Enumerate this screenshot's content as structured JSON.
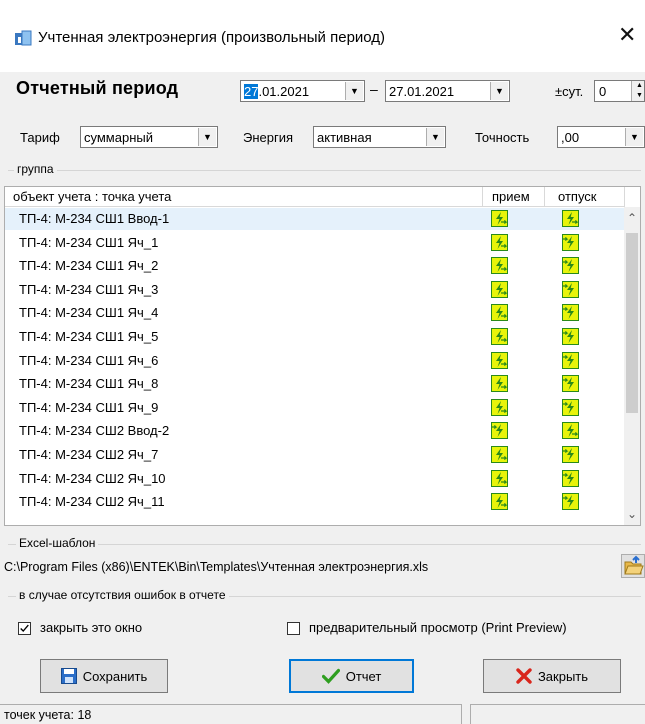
{
  "window": {
    "title": "Учтенная электроэнергия (произвольный период)",
    "close_glyph": "✕"
  },
  "period": {
    "label": "Отчетный период",
    "date_from": {
      "selected_part": "27",
      "rest": ".01.2021"
    },
    "dash": "–",
    "date_to": "27.01.2021",
    "days_label": "±сут.",
    "days_value": "0"
  },
  "filters": {
    "tariff_label": "Тариф",
    "tariff_value": "суммарный",
    "energy_label": "Энергия",
    "energy_value": "активная",
    "precision_label": "Точность",
    "precision_value": ",00"
  },
  "group": {
    "title": "группа",
    "columns": [
      "объект учета : точка учета",
      "прием",
      "отпуск"
    ],
    "rows": [
      {
        "name": "ТП-4: М-234 СШ1 Ввод-1",
        "recv": "b",
        "send": "b"
      },
      {
        "name": "ТП-4: М-234 СШ1 Яч_1",
        "recv": "b",
        "send": "a"
      },
      {
        "name": "ТП-4: М-234 СШ1 Яч_2",
        "recv": "b",
        "send": "a"
      },
      {
        "name": "ТП-4: М-234 СШ1 Яч_3",
        "recv": "b",
        "send": "a"
      },
      {
        "name": "ТП-4: М-234 СШ1 Яч_4",
        "recv": "b",
        "send": "a"
      },
      {
        "name": "ТП-4: М-234 СШ1 Яч_5",
        "recv": "b",
        "send": "a"
      },
      {
        "name": "ТП-4: М-234 СШ1 Яч_6",
        "recv": "b",
        "send": "a"
      },
      {
        "name": "ТП-4: М-234 СШ1 Яч_8",
        "recv": "b",
        "send": "a"
      },
      {
        "name": "ТП-4: М-234 СШ1 Яч_9",
        "recv": "b",
        "send": "a"
      },
      {
        "name": "ТП-4: М-234 СШ2 Ввод-2",
        "recv": "a",
        "send": "b"
      },
      {
        "name": "ТП-4: М-234 СШ2 Яч_7",
        "recv": "b",
        "send": "a"
      },
      {
        "name": "ТП-4: М-234 СШ2 Яч_10",
        "recv": "b",
        "send": "a"
      },
      {
        "name": "ТП-4: М-234 СШ2 Яч_11",
        "recv": "b",
        "send": "a"
      }
    ]
  },
  "excel": {
    "title": "Excel-шаблон",
    "path": "C:\\Program Files (x86)\\ENTEK\\Bin\\Templates\\Учтенная электроэнергия.xls"
  },
  "errors_group": {
    "title": "в случае отсутствия ошибок в отчете",
    "close_window_label": "закрыть это окно",
    "close_window_checked": true,
    "preview_label": "предварительный просмотр (Print Preview)",
    "preview_checked": false
  },
  "buttons": {
    "save": "Сохранить",
    "report": "Отчет",
    "close": "Закрыть"
  },
  "status": {
    "points": "точек учета: 18"
  },
  "colors": {
    "icon_fill": "#e8f40a",
    "icon_stroke": "#2a8a1a",
    "selection": "#0078d7"
  }
}
